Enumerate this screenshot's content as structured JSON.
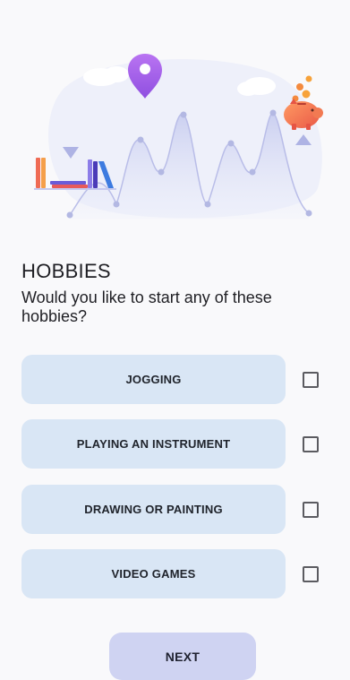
{
  "header": {
    "title": "HOBBIES",
    "question": "Would you like to start any of these hobbies?"
  },
  "hero": {
    "icons": [
      "location-pin-icon",
      "books-icon",
      "piggy-bank-icon",
      "coins-icon",
      "triangle-down-icon",
      "triangle-up-icon",
      "cloud-icon"
    ],
    "colors": {
      "pin": "#a561e8",
      "curve": "#c9cdf0",
      "piggy": "#f27a52",
      "coin": "#f7a23a"
    }
  },
  "options": [
    {
      "label": "JOGGING",
      "checked": false
    },
    {
      "label": "PLAYING AN INSTRUMENT",
      "checked": false
    },
    {
      "label": "DRAWING OR PAINTING",
      "checked": false
    },
    {
      "label": "VIDEO GAMES",
      "checked": false
    }
  ],
  "footer": {
    "next_label": "NEXT"
  },
  "colors": {
    "background": "#f9f9fb",
    "option_bg": "#d9e6f5",
    "next_bg": "#cfd3f2"
  }
}
